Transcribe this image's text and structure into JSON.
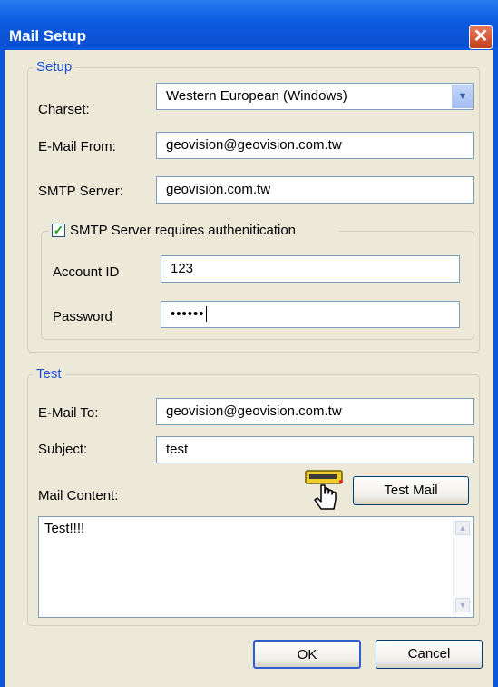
{
  "window": {
    "title": "Mail Setup",
    "close_glyph": "✕"
  },
  "setup": {
    "legend": "Setup",
    "charset": {
      "label": "Charset:",
      "value": "Western European (Windows)"
    },
    "email_from": {
      "label": "E-Mail From:",
      "value": "geovision@geovision.com.tw"
    },
    "smtp_server": {
      "label": "SMTP Server:",
      "value": "geovision.com.tw"
    },
    "auth": {
      "checkbox_label": "SMTP Server requires authenitication",
      "checked": true,
      "account_id": {
        "label": "Account ID",
        "value": "123"
      },
      "password": {
        "label": "Password",
        "masked": "••••••"
      }
    }
  },
  "test": {
    "legend": "Test",
    "email_to": {
      "label": "E-Mail To:",
      "value": "geovision@geovision.com.tw"
    },
    "subject": {
      "label": "Subject:",
      "value": "test"
    },
    "mail_content": {
      "label": "Mail Content:",
      "value": "Test!!!!"
    },
    "test_mail_button": "Test Mail"
  },
  "footer": {
    "ok": "OK",
    "cancel": "Cancel"
  },
  "icons": {
    "cursor": "hand-pointer-icon",
    "dropdown": "chevron-down-icon",
    "scroll_up": "scroll-up-arrow-icon",
    "scroll_down": "scroll-down-arrow-icon"
  }
}
